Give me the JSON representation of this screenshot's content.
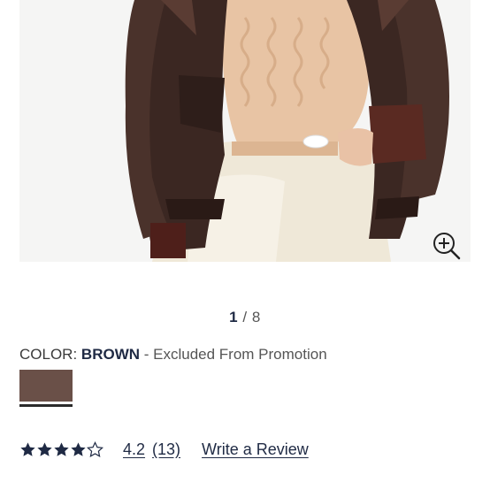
{
  "gallery": {
    "current_index": "1",
    "separator": "/",
    "total": "8",
    "zoom_icon": "zoom-in-icon"
  },
  "product": {
    "color_label": "COLOR:",
    "color_value": "BROWN",
    "color_note": " - Excluded From Promotion",
    "swatch_color": "#6a5048"
  },
  "reviews": {
    "rating": 4.2,
    "rating_text": "4.2",
    "count_text": "(13)",
    "write_review_label": "Write a Review",
    "star_icon": "star-icon",
    "stars_filled": 4,
    "stars_total": 5
  },
  "colors": {
    "accent_navy": "#1f2a44",
    "jacket_brown": "#3b2722",
    "sweater_peach": "#e8c4a4",
    "pants_cream": "#efe8d8"
  }
}
